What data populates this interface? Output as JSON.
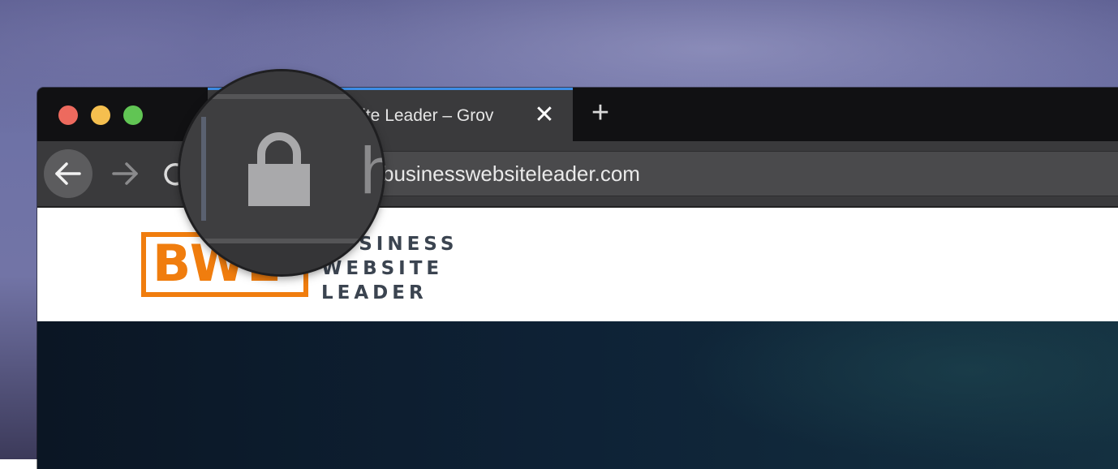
{
  "browser": {
    "active_tab": {
      "title": "Business Website Leader – Grow",
      "visible_title": "bsite Leader – Grov",
      "close_label": "✕",
      "accent_color": "#3d8ee6"
    },
    "new_tab_label": "+",
    "address_bar": {
      "url": "businesswebsiteleader.com",
      "magnified_scheme_char": "h",
      "lock_icon": "lock-icon"
    },
    "traffic_lights": {
      "close_color": "#ed6a5e",
      "minimize_color": "#f5bf4f",
      "zoom_color": "#61c554"
    }
  },
  "site": {
    "logo_mark": "BWL",
    "logo_lines": [
      "BUSINESS",
      "WEBSITE",
      "LEADER"
    ],
    "brand_color": "#f07d0e",
    "text_color": "#3b4450"
  }
}
